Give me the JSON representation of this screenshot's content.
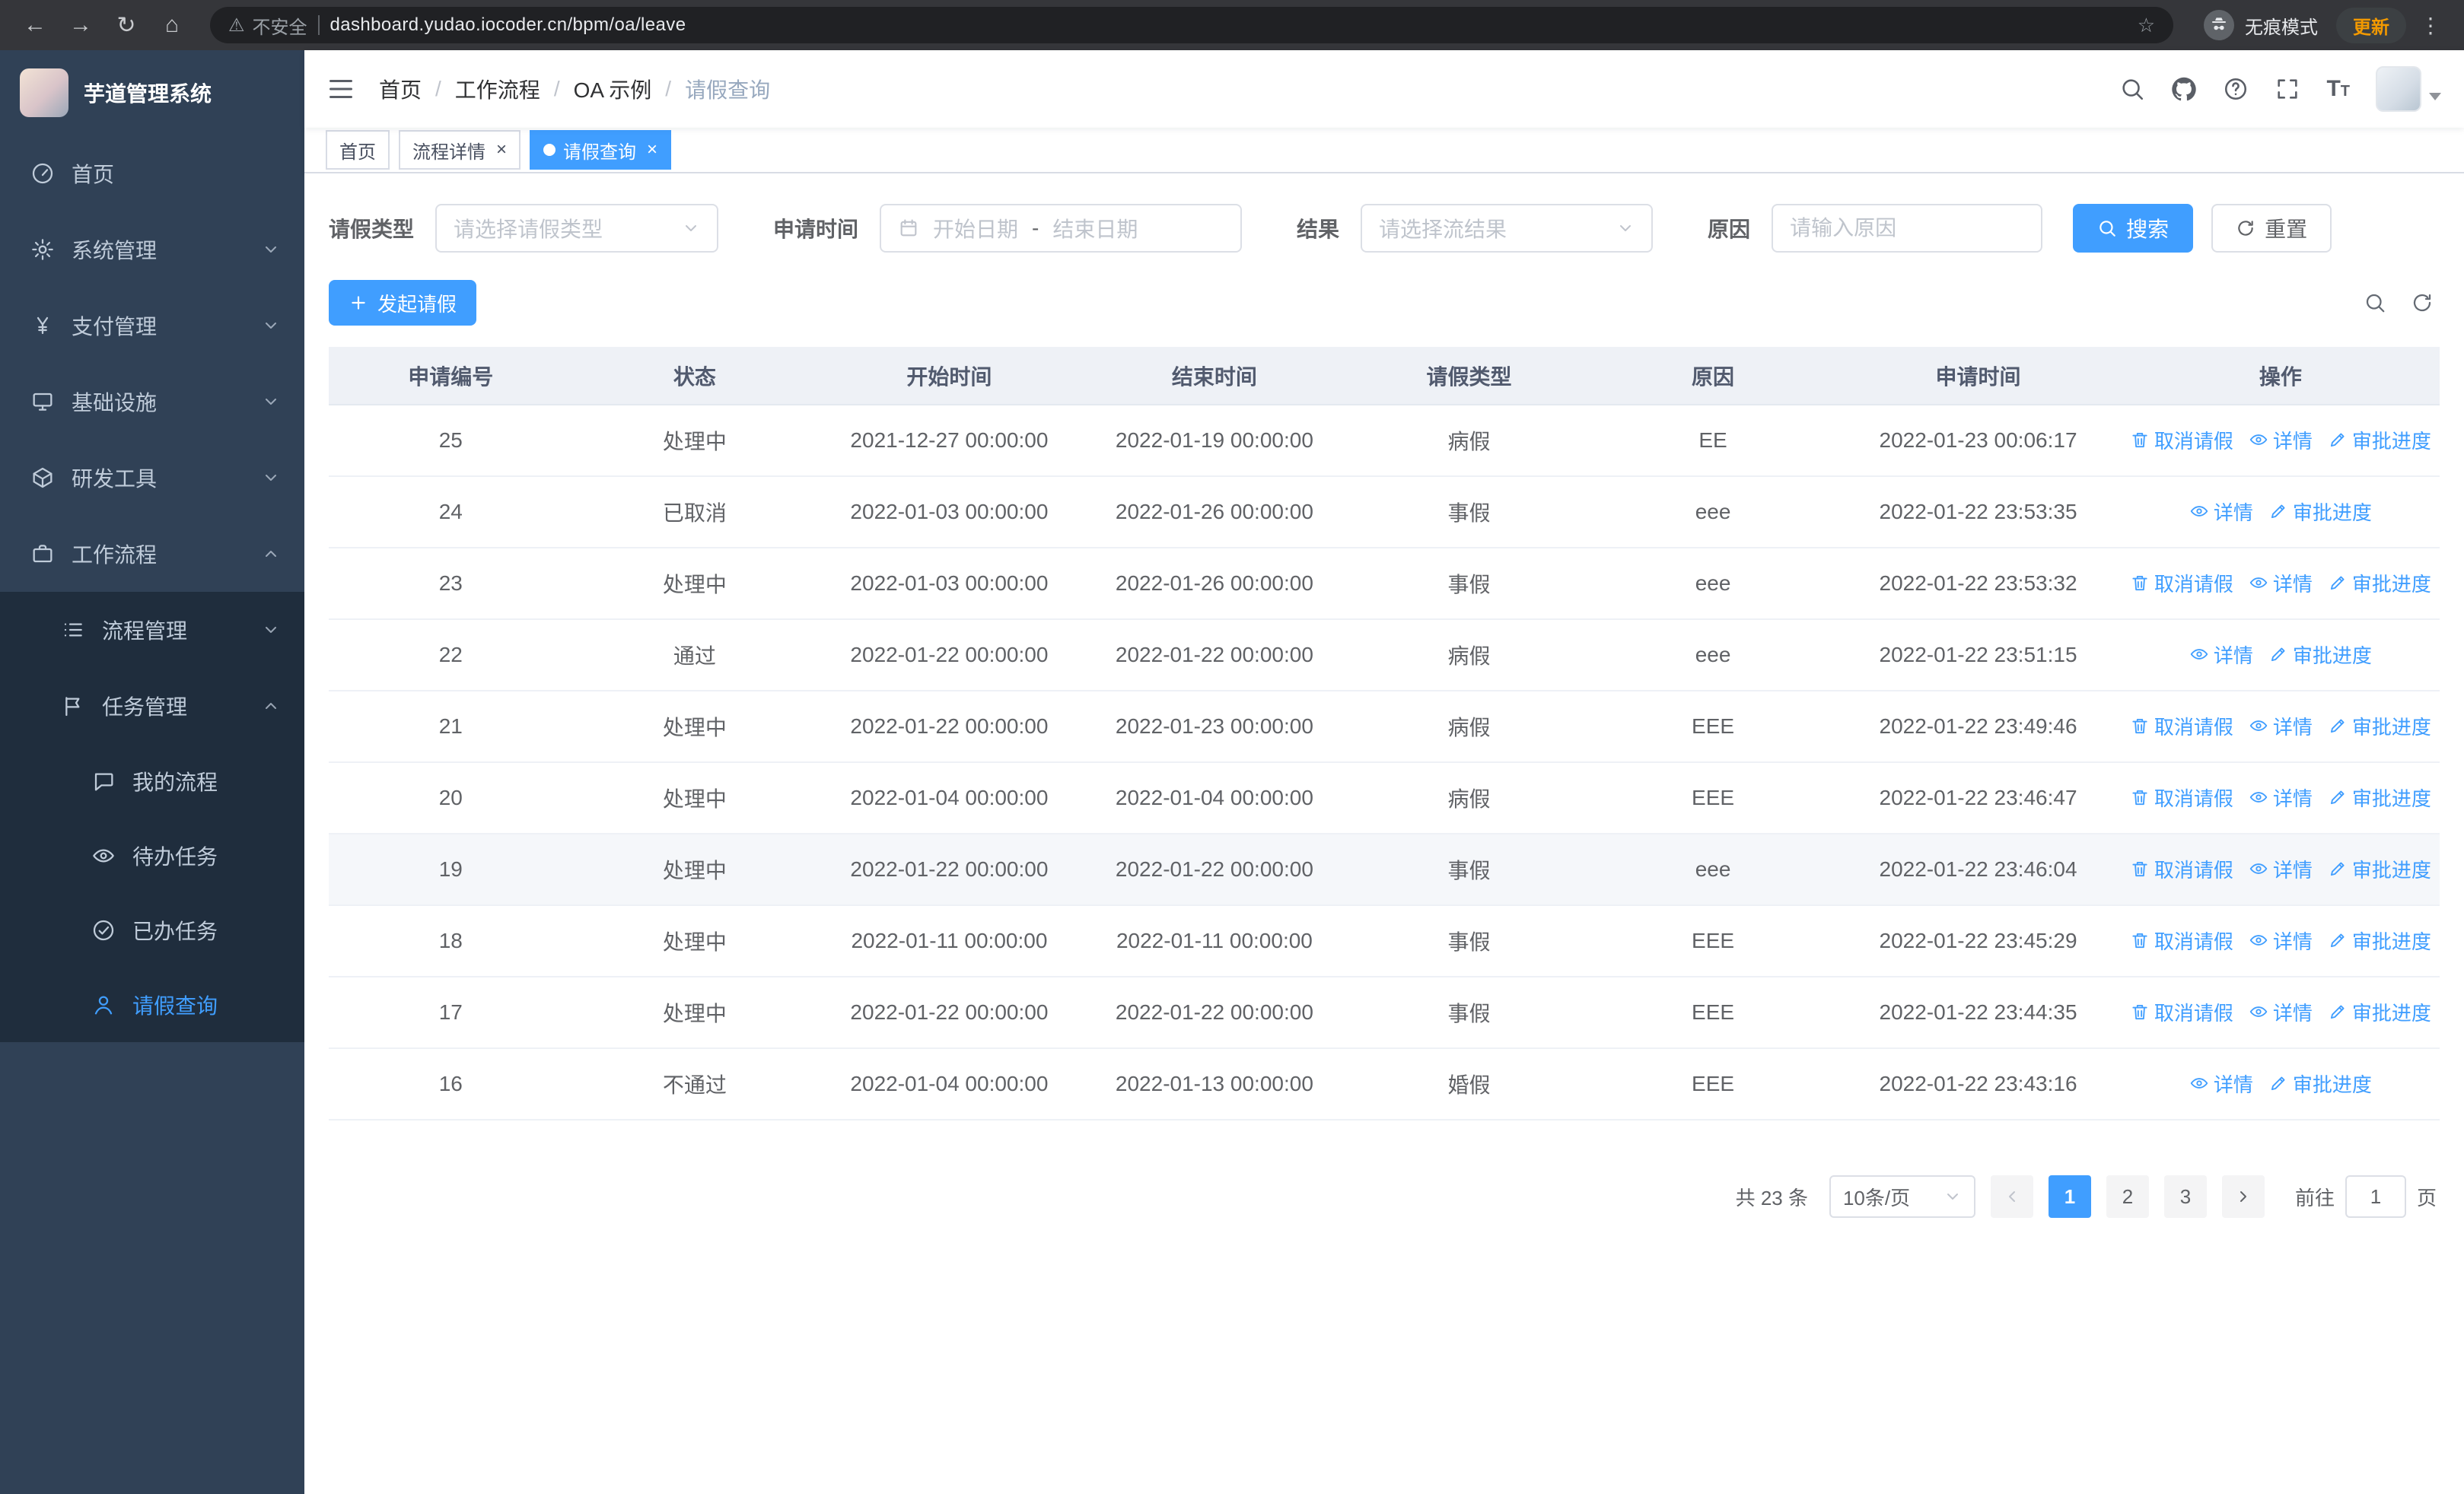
{
  "colors": {
    "primary": "#409EFF",
    "sidebar_bg": "#304156",
    "submenu_bg": "#1f2d3d",
    "update_text": "#f29900"
  },
  "browser": {
    "security_warning": "不安全",
    "url": "dashboard.yudao.iocoder.cn/bpm/oa/leave",
    "incognito_label": "无痕模式",
    "update_label": "更新"
  },
  "sidebar": {
    "title": "芋道管理系统",
    "menu": [
      {
        "label": "首页"
      },
      {
        "label": "系统管理"
      },
      {
        "label": "支付管理"
      },
      {
        "label": "基础设施"
      },
      {
        "label": "研发工具"
      },
      {
        "label": "工作流程"
      },
      {
        "label": "流程管理"
      },
      {
        "label": "任务管理"
      },
      {
        "label": "我的流程"
      },
      {
        "label": "待办任务"
      },
      {
        "label": "已办任务"
      },
      {
        "label": "请假查询"
      }
    ]
  },
  "breadcrumb": {
    "separator": "/",
    "items": [
      "首页",
      "工作流程",
      "OA 示例",
      "请假查询"
    ]
  },
  "tabs": [
    {
      "label": "首页"
    },
    {
      "label": "流程详情"
    },
    {
      "label": "请假查询"
    }
  ],
  "filters": {
    "leave_type_label": "请假类型",
    "leave_type_placeholder": "请选择请假类型",
    "apply_time_label": "申请时间",
    "start_date_placeholder": "开始日期",
    "range_separator": "-",
    "end_date_placeholder": "结束日期",
    "result_label": "结果",
    "result_placeholder": "请选择流结果",
    "reason_label": "原因",
    "reason_placeholder": "请输入原因",
    "search_button": "搜索",
    "reset_button": "重置"
  },
  "toolbar": {
    "create_button": "发起请假"
  },
  "table": {
    "columns": [
      "申请编号",
      "状态",
      "开始时间",
      "结束时间",
      "请假类型",
      "原因",
      "申请时间",
      "操作"
    ],
    "action_labels": {
      "cancel": "取消请假",
      "detail": "详情",
      "progress": "审批进度"
    },
    "rows": [
      {
        "id": "25",
        "status": "处理中",
        "start": "2021-12-27 00:00:00",
        "end": "2022-01-19 00:00:00",
        "type": "病假",
        "reason": "EE",
        "apply_time": "2022-01-23 00:06:17",
        "actions": [
          "cancel",
          "detail",
          "progress"
        ],
        "highlighted": false
      },
      {
        "id": "24",
        "status": "已取消",
        "start": "2022-01-03 00:00:00",
        "end": "2022-01-26 00:00:00",
        "type": "事假",
        "reason": "eee",
        "apply_time": "2022-01-22 23:53:35",
        "actions": [
          "detail",
          "progress"
        ],
        "highlighted": false
      },
      {
        "id": "23",
        "status": "处理中",
        "start": "2022-01-03 00:00:00",
        "end": "2022-01-26 00:00:00",
        "type": "事假",
        "reason": "eee",
        "apply_time": "2022-01-22 23:53:32",
        "actions": [
          "cancel",
          "detail",
          "progress"
        ],
        "highlighted": false
      },
      {
        "id": "22",
        "status": "通过",
        "start": "2022-01-22 00:00:00",
        "end": "2022-01-22 00:00:00",
        "type": "病假",
        "reason": "eee",
        "apply_time": "2022-01-22 23:51:15",
        "actions": [
          "detail",
          "progress"
        ],
        "highlighted": false
      },
      {
        "id": "21",
        "status": "处理中",
        "start": "2022-01-22 00:00:00",
        "end": "2022-01-23 00:00:00",
        "type": "病假",
        "reason": "EEE",
        "apply_time": "2022-01-22 23:49:46",
        "actions": [
          "cancel",
          "detail",
          "progress"
        ],
        "highlighted": false
      },
      {
        "id": "20",
        "status": "处理中",
        "start": "2022-01-04 00:00:00",
        "end": "2022-01-04 00:00:00",
        "type": "病假",
        "reason": "EEE",
        "apply_time": "2022-01-22 23:46:47",
        "actions": [
          "cancel",
          "detail",
          "progress"
        ],
        "highlighted": false
      },
      {
        "id": "19",
        "status": "处理中",
        "start": "2022-01-22 00:00:00",
        "end": "2022-01-22 00:00:00",
        "type": "事假",
        "reason": "eee",
        "apply_time": "2022-01-22 23:46:04",
        "actions": [
          "cancel",
          "detail",
          "progress"
        ],
        "highlighted": true
      },
      {
        "id": "18",
        "status": "处理中",
        "start": "2022-01-11 00:00:00",
        "end": "2022-01-11 00:00:00",
        "type": "事假",
        "reason": "EEE",
        "apply_time": "2022-01-22 23:45:29",
        "actions": [
          "cancel",
          "detail",
          "progress"
        ],
        "highlighted": false
      },
      {
        "id": "17",
        "status": "处理中",
        "start": "2022-01-22 00:00:00",
        "end": "2022-01-22 00:00:00",
        "type": "事假",
        "reason": "EEE",
        "apply_time": "2022-01-22 23:44:35",
        "actions": [
          "cancel",
          "detail",
          "progress"
        ],
        "highlighted": false
      },
      {
        "id": "16",
        "status": "不通过",
        "start": "2022-01-04 00:00:00",
        "end": "2022-01-13 00:00:00",
        "type": "婚假",
        "reason": "EEE",
        "apply_time": "2022-01-22 23:43:16",
        "actions": [
          "detail",
          "progress"
        ],
        "highlighted": false
      }
    ]
  },
  "pagination": {
    "total_text": "共 23 条",
    "page_size": "10条/页",
    "pages": [
      "1",
      "2",
      "3"
    ],
    "active_page": "1",
    "goto_label": "前往",
    "goto_value": "1",
    "goto_unit": "页"
  }
}
